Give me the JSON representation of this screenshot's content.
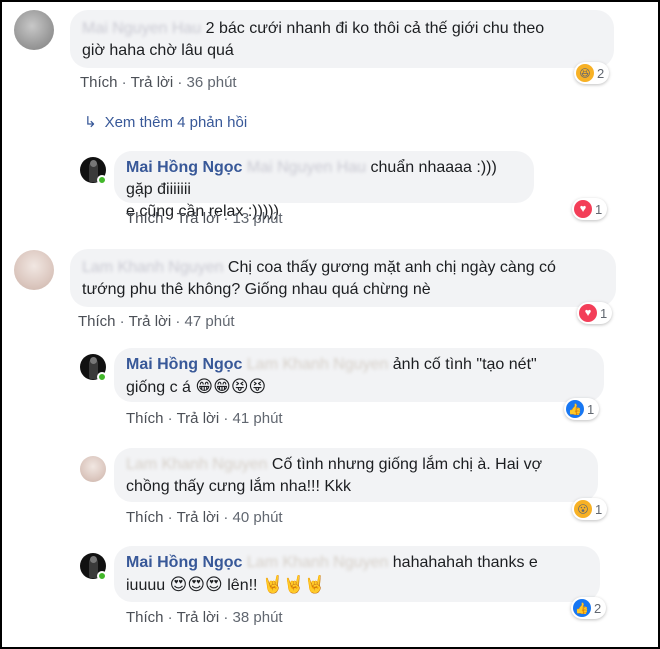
{
  "actions": {
    "like": "Thích",
    "reply": "Trả lời"
  },
  "view_more": "Xem thêm 4 phản hồi",
  "comments": [
    {
      "author": "Mai Nguyen Hau",
      "text": "2 bác cưới nhanh đi ko thôi cả thế giới chu theo giờ haha chờ lâu quá",
      "line1": "2 bác cưới nhanh đi ko thôi cả thế giới chu theo",
      "line2": "giờ haha chờ lâu quá",
      "time": "36 phút",
      "reaction": {
        "type": "haha",
        "icon": "😆",
        "count": "2"
      }
    },
    {
      "author": "Mai Hồng Ngọc",
      "tag": "Mai Nguyen Hau",
      "line1": "chuẩn nhaaaa :))) gặp điiiiiii",
      "line2": "e cũng cần relax :)))))",
      "time": "13 phút",
      "reaction": {
        "type": "love",
        "icon": "♥",
        "count": "1"
      }
    },
    {
      "author": "Lam Khanh Nguyen",
      "line1": "Chị coa thấy gương mặt anh chị ngày càng có",
      "line2": "tướng phu thê không? Giống nhau quá chừng nè",
      "time": "47 phút",
      "reaction": {
        "type": "love",
        "icon": "♥",
        "count": "1"
      }
    },
    {
      "author": "Mai Hồng Ngọc",
      "tag": "Lam Khanh Nguyen",
      "line1": "ảnh cố tình \"tạo nét\"",
      "line2": "giống c á",
      "line2_emoji": "😁😁😝😝",
      "time": "41 phút",
      "reaction": {
        "type": "like",
        "icon": "👍",
        "count": "1"
      }
    },
    {
      "author": "Lam Khanh Nguyen",
      "line1": "Cố tình nhưng giống lắm chị à. Hai vợ",
      "line2": "chồng thấy cưng lắm nha!!! Kkk",
      "time": "40 phút",
      "reaction": {
        "type": "wow",
        "icon": "😮",
        "count": "1"
      }
    },
    {
      "author": "Mai Hồng Ngọc",
      "tag": "Lam Khanh Nguyen",
      "line1": "hahahahah thanks e",
      "line2_pre": "iuuuu",
      "line2_emoji": "😍😍😍",
      "line2_post": "lên!!",
      "line2_emoji2": "🤘🤘🤘",
      "time": "38 phút",
      "reaction": {
        "type": "like",
        "icon": "👍",
        "count": "2"
      }
    }
  ],
  "colors": {
    "author": "#385898",
    "bubble": "#f2f3f5",
    "online": "#42b72a"
  }
}
